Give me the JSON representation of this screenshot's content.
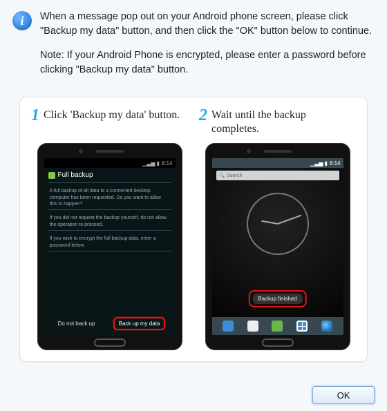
{
  "icon_glyph": "i",
  "paragraph1": "When a message pop out on your Android phone screen, please click \"Backup my data\" button, and then click the \"OK\" button below to continue.",
  "paragraph2": "Note: If your Android Phone is encrypted, please enter a password before clicking \"Backup my data\" button.",
  "steps": [
    {
      "num": "1",
      "title": "Click 'Backup my data' button."
    },
    {
      "num": "2",
      "title": "Wait until the backup completes."
    }
  ],
  "phone1": {
    "time": "8:14",
    "heading": "Full backup",
    "para_a": "A full backup of all data to a connected desktop computer has been requested. Do you want to allow this to happen?",
    "para_b": "If you did not request the backup yourself, do not allow the operation to proceed.",
    "para_c": "If you wish to encrypt the full backup data, enter a password below.",
    "btn_left": "Do not back up",
    "btn_right": "Back up my data"
  },
  "phone2": {
    "time": "8:14",
    "search_placeholder": "Search",
    "toast": "Backup finished"
  },
  "footer": {
    "ok_label": "OK"
  }
}
